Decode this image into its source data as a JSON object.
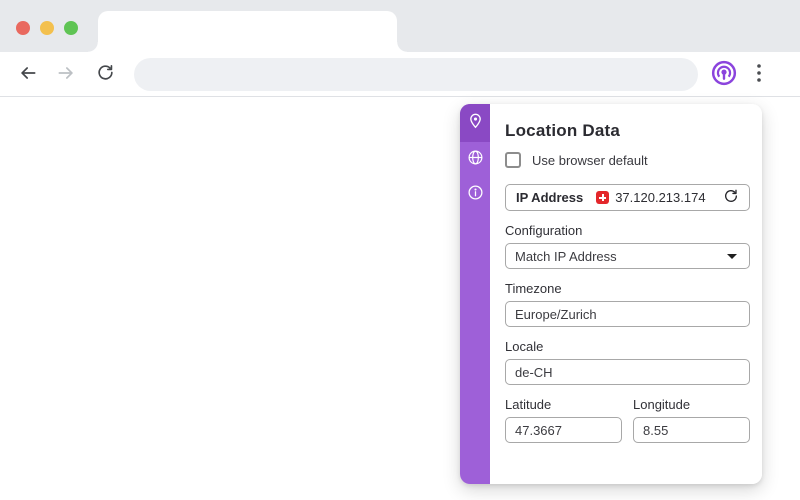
{
  "browser": {
    "traffic_lights": {
      "close": "red",
      "minimize": "yellow",
      "maximize": "green"
    },
    "toolbar": {
      "back_icon": "arrow-left",
      "forward_icon": "arrow-right",
      "reload_icon": "reload",
      "url_value": "",
      "extension_icon": "vytal-broadcast",
      "menu_icon": "three-dot-menu"
    }
  },
  "panel": {
    "title": "Location Data",
    "sidebar": {
      "items": [
        {
          "name": "location",
          "icon": "location-pin",
          "active": true
        },
        {
          "name": "browser",
          "icon": "globe",
          "active": false
        },
        {
          "name": "about",
          "icon": "info",
          "active": false
        }
      ]
    },
    "use_browser_default": {
      "label": "Use browser default",
      "checked": false
    },
    "ip": {
      "label": "IP Address",
      "flag": "switzerland-flag",
      "value": "37.120.213.174",
      "refresh_icon": "refresh"
    },
    "configuration": {
      "label": "Configuration",
      "selected": "Match IP Address"
    },
    "timezone": {
      "label": "Timezone",
      "value": "Europe/Zurich"
    },
    "locale": {
      "label": "Locale",
      "value": "de-CH"
    },
    "latitude": {
      "label": "Latitude",
      "value": "47.3667"
    },
    "longitude": {
      "label": "Longitude",
      "value": "8.55"
    }
  },
  "colors": {
    "accent_purple": "#9e60d8",
    "accent_purple_dark": "#8a49c4",
    "flag_red": "#e3272b",
    "tabstrip_grey": "#e7e9ec",
    "urlbar_grey": "#eef0f3"
  }
}
